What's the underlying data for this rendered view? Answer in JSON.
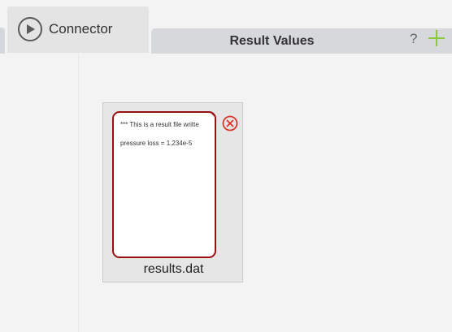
{
  "tabs": {
    "connector_label": "Connector",
    "result_values_label": "Result Values"
  },
  "toolbar": {
    "help_label": "?",
    "add_icon": "plus-icon",
    "accent_color": "#8dc63f"
  },
  "file": {
    "name": "results.dat",
    "preview_lines": [
      "*** This is a result file writte",
      "pressure loss = 1.234e-5"
    ],
    "border_color": "#9a0f14",
    "remove_icon": "close-circle-icon"
  }
}
